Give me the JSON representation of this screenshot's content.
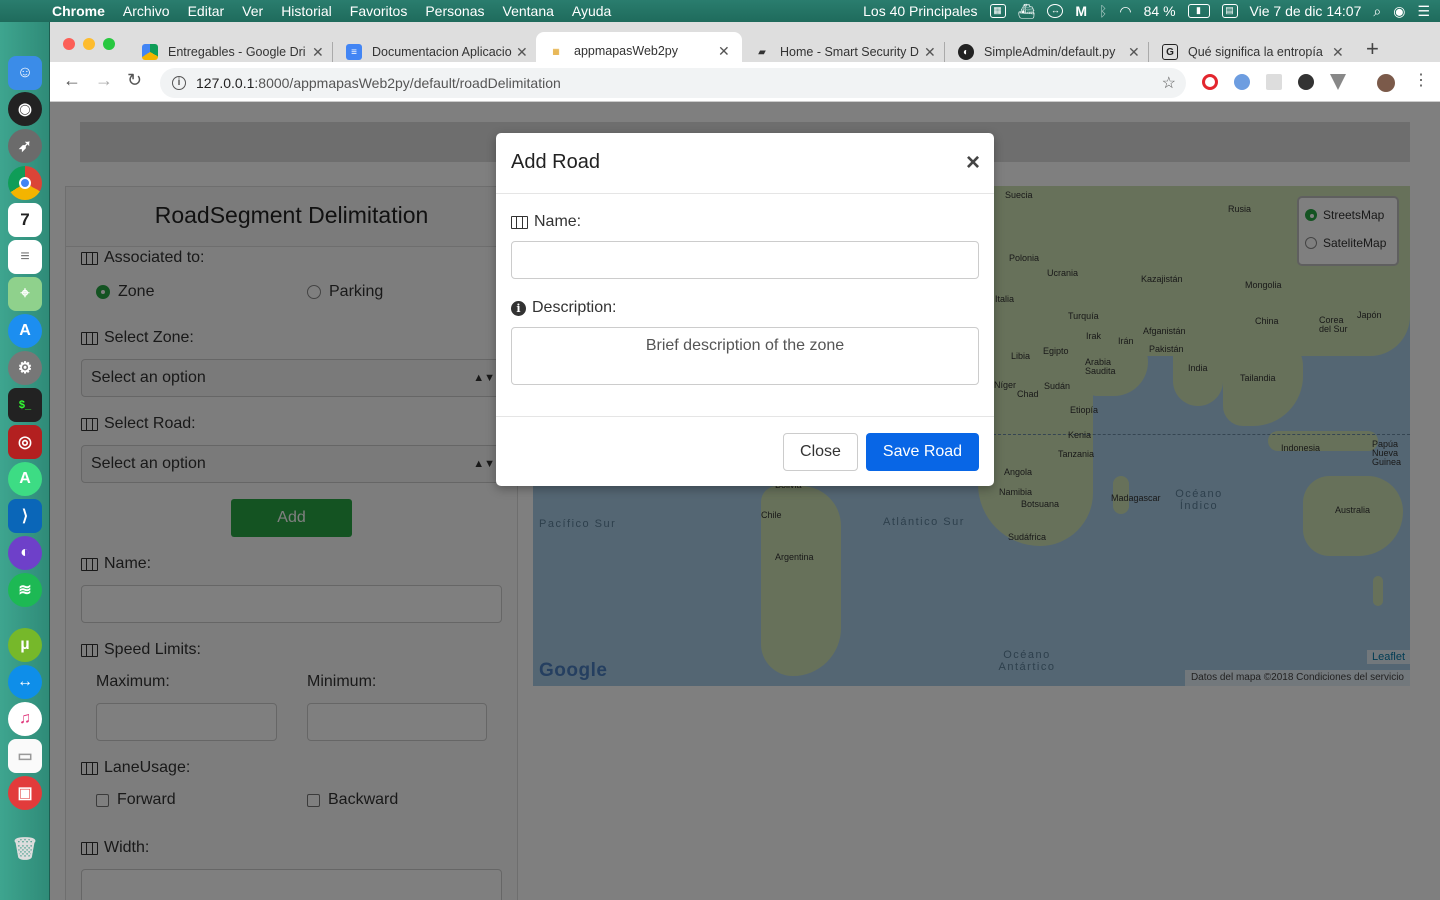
{
  "menubar": {
    "app": "Chrome",
    "items": [
      "Archivo",
      "Editar",
      "Ver",
      "Historial",
      "Favoritos",
      "Personas",
      "Ventana",
      "Ayuda"
    ],
    "now_playing": "Los 40 Principales",
    "battery": "84 %",
    "datetime": "Vie 7 de dic  14:07"
  },
  "tabs": [
    {
      "label": "Entregables - Google Dri",
      "icon": "google-drive-icon"
    },
    {
      "label": "Documentacion Aplicacio",
      "icon": "google-docs-icon"
    },
    {
      "label": "appmapasWeb2py",
      "icon": "web2py-icon",
      "active": true
    },
    {
      "label": "Home - Smart Security D",
      "icon": "book-icon"
    },
    {
      "label": "SimpleAdmin/default.py",
      "icon": "github-icon"
    },
    {
      "label": "Qué significa la entropía",
      "icon": "g-icon"
    }
  ],
  "url": {
    "host": "127.0.0.1",
    "rest": ":8000/appmapasWeb2py/default/roadDelimitation"
  },
  "panel": {
    "title": "RoadSegment Delimitation",
    "associated_label": "Associated to:",
    "radio_zone": "Zone",
    "radio_parking": "Parking",
    "select_zone_label": "Select Zone:",
    "select_zone_value": "Select an option",
    "select_road_label": "Select Road:",
    "select_road_value": "Select an option",
    "add_button": "Add",
    "name_label": "Name:",
    "speed_label": "Speed Limits:",
    "max_label": "Maximum:",
    "min_label": "Minimum:",
    "lane_label": "LaneUsage:",
    "forward": "Forward",
    "backward": "Backward",
    "width_label": "Width:"
  },
  "map": {
    "layers": [
      "StreetsMap",
      "SateliteMap"
    ],
    "selected_layer": "StreetsMap",
    "google": "Google",
    "leaflet": "Leaflet",
    "attribution": "Datos del mapa ©2018   Condiciones del servicio",
    "labels": [
      "Suecia",
      "Rusia",
      "Polonia",
      "Ucrania",
      "Kazajistán",
      "Mongolia",
      "Italia",
      "Turquía",
      "China",
      "Japón",
      "Corea del Sur",
      "Irak",
      "Irán",
      "Afganistán",
      "Pakistán",
      "Libia",
      "Egipto",
      "Arabia Saudita",
      "India",
      "Tailandia",
      "Chad",
      "Sudán",
      "Etiopía",
      "Kenia",
      "Tanzania",
      "Indonesia",
      "Papúa Nueva Guinea",
      "Angola",
      "Namibia",
      "Botsuana",
      "Madagascar",
      "Sudáfrica",
      "Australia",
      "Chile",
      "Argentina",
      "Bolivia",
      "Níger"
    ],
    "oceans": [
      "Pacífico Sur",
      "Atlántico Sur",
      "Océano Índico",
      "Océano Antártico"
    ]
  },
  "modal": {
    "title": "Add Road",
    "name_label": "Name:",
    "name_value": "",
    "description_label": "Description:",
    "description_placeholder": "Brief description of the zone",
    "close_button": "Close",
    "save_button": "Save Road"
  }
}
